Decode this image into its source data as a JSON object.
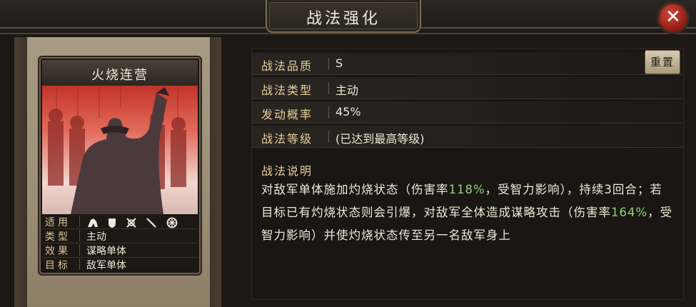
{
  "header": {
    "title": "战法强化"
  },
  "card": {
    "name": "火烧连营",
    "stats": [
      {
        "key": "适用",
        "value": ""
      },
      {
        "key": "类型",
        "value": "主动"
      },
      {
        "key": "效果",
        "value": "谋略单体"
      },
      {
        "key": "目标",
        "value": "敌军单体"
      }
    ],
    "applicable_icons": [
      "cavalry-icon",
      "shield-icon",
      "bow-icon",
      "spear-icon",
      "siege-wheel-icon"
    ]
  },
  "info": {
    "rows": [
      {
        "key": "战法品质",
        "value": "S"
      },
      {
        "key": "战法类型",
        "value": "主动"
      },
      {
        "key": "发动概率",
        "value": "45%"
      },
      {
        "key": "战法等级",
        "value": "(已达到最高等级)"
      }
    ],
    "reset_label": "重置"
  },
  "description": {
    "heading": "战法说明",
    "seg1": "对敌军单体施加灼烧状态（伤害率",
    "pct1": "118%",
    "seg2": "，受智力影响），持续3回合；若目标已有灼烧状态则会引爆，对敌军全体造成谋略攻击（伤害率",
    "pct2": "164%",
    "seg3": "，受智力影响）并使灼烧状态传至另一名敌军身上"
  },
  "colors": {
    "accent_gold": "#e5cf9f",
    "highlight_green": "#8fd27a",
    "close_red": "#c0392b"
  }
}
